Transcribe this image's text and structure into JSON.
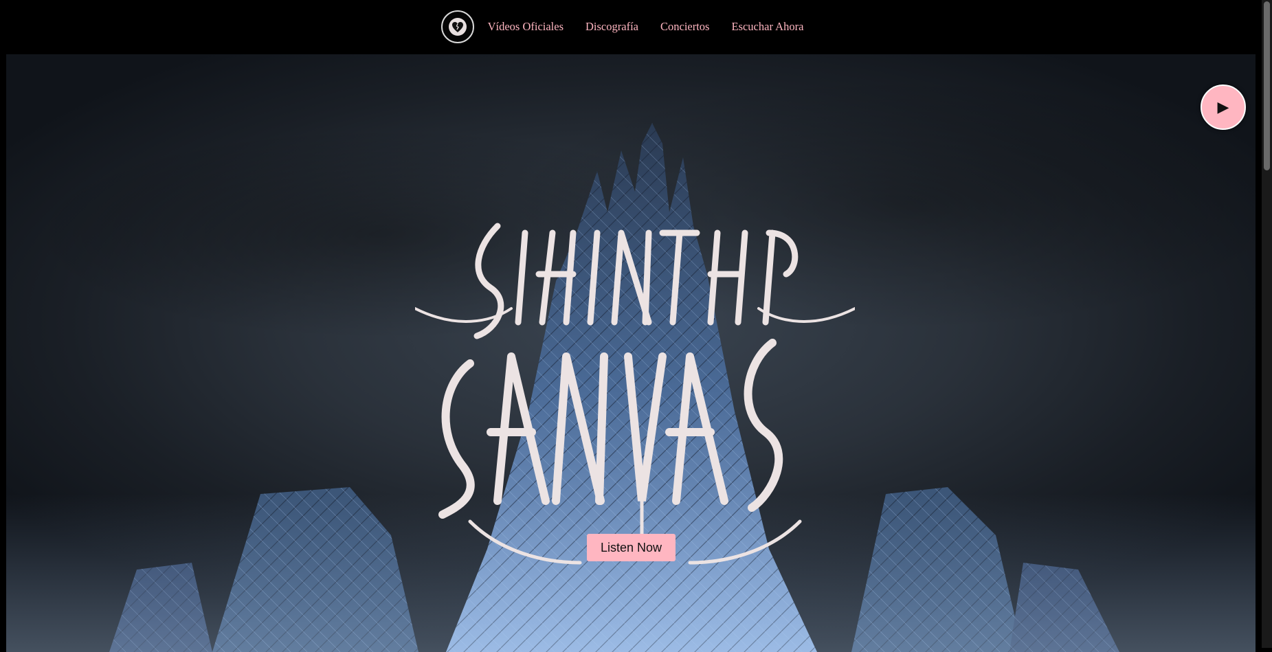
{
  "nav": {
    "logo_icon": "broken-heart-icon",
    "links": [
      {
        "label": "Vídeos Oficiales"
      },
      {
        "label": "Discografía"
      },
      {
        "label": "Conciertos"
      },
      {
        "label": "Escuchar Ahora"
      }
    ]
  },
  "hero": {
    "band_name": "STAIN THE CANVAS",
    "listen_button": "Listen Now",
    "play_button_icon": "play-icon",
    "play_button_glyph": "▶"
  },
  "colors": {
    "accent": "#ffb6c1",
    "nav_background": "#000000",
    "logo_fill": "#ece3e3"
  }
}
